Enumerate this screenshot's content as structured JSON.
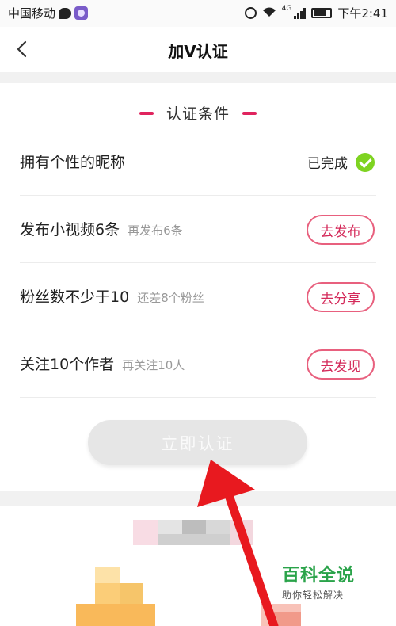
{
  "status_bar": {
    "carrier": "中国移动",
    "network": "4G",
    "time": "下午2:41",
    "icons": [
      "message-icon",
      "app-icon",
      "alarm-icon",
      "wifi-icon",
      "signal-icon",
      "battery-icon"
    ]
  },
  "nav": {
    "title": "加V认证",
    "back_icon": "chevron-left-icon"
  },
  "section": {
    "title": "认证条件"
  },
  "conditions": [
    {
      "label": "拥有个性的昵称",
      "hint": "",
      "status": "已完成",
      "status_icon": "check-circle-icon"
    },
    {
      "label": "发布小视频6条",
      "hint": "再发布6条",
      "action": "去发布"
    },
    {
      "label": "粉丝数不少于10",
      "hint": "还差8个粉丝",
      "action": "去分享"
    },
    {
      "label": "关注10个作者",
      "hint": "再关注10人",
      "action": "去发现"
    }
  ],
  "verify_button": "立即认证",
  "watermark": {
    "title": "百科全说",
    "subtitle": "助你轻松解决"
  },
  "colors": {
    "accent": "#e0245e",
    "success": "#7ed321",
    "arrow": "#e8191f",
    "watermark": "#2aa34a"
  }
}
